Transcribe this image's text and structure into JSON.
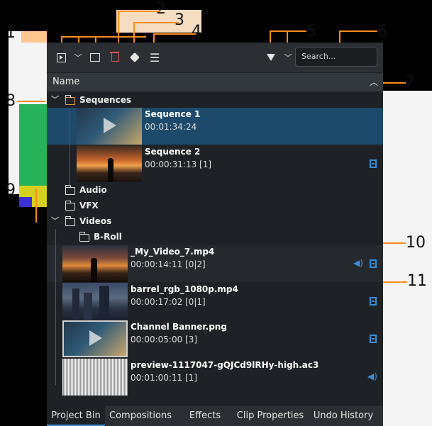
{
  "toolbar": {
    "search_placeholder": "Search...",
    "icons": [
      "add-clip-icon",
      "chevron-down-icon",
      "new-folder-icon",
      "delete-icon",
      "tag-icon",
      "menu-icon",
      "filter-icon",
      "chevron-down-icon"
    ]
  },
  "header": {
    "name_label": "Name"
  },
  "callouts": [
    "1",
    "2",
    "3",
    "4",
    "5",
    "6",
    "7",
    "8",
    "9",
    "10",
    "11"
  ],
  "tree": {
    "sequences": "Sequences",
    "seq1": {
      "name": "Sequence 1",
      "duration": "00:01:34:24"
    },
    "seq2": {
      "name": "Sequence 2",
      "duration": "00:00:31:13 [1]"
    },
    "audio": "Audio",
    "vfx": "VFX",
    "videos": "Videos",
    "broll": "B-Roll",
    "clip1": {
      "name": "_My_Video_7.mp4",
      "duration": "00:00:14:11 [0|2]"
    },
    "clip2": {
      "name": "barrel_rgb_1080p.mp4",
      "duration": "00:00:17:02 [0|1]"
    },
    "clip3": {
      "name": "Channel Banner.png",
      "duration": "00:00:05:00 [3]"
    },
    "clip4": {
      "name": "preview-1117047-gQJCd9lRHy-high.ac3",
      "duration": "00:01:00:11 [1]"
    }
  },
  "tabs": [
    "Project Bin",
    "Compositions",
    "Effects",
    "Clip Properties",
    "Undo History"
  ],
  "colors": {
    "accent": "#3c8fd8",
    "annotation": "#ff8c1a",
    "selection": "#1d4a6b",
    "delete": "#e05050"
  }
}
